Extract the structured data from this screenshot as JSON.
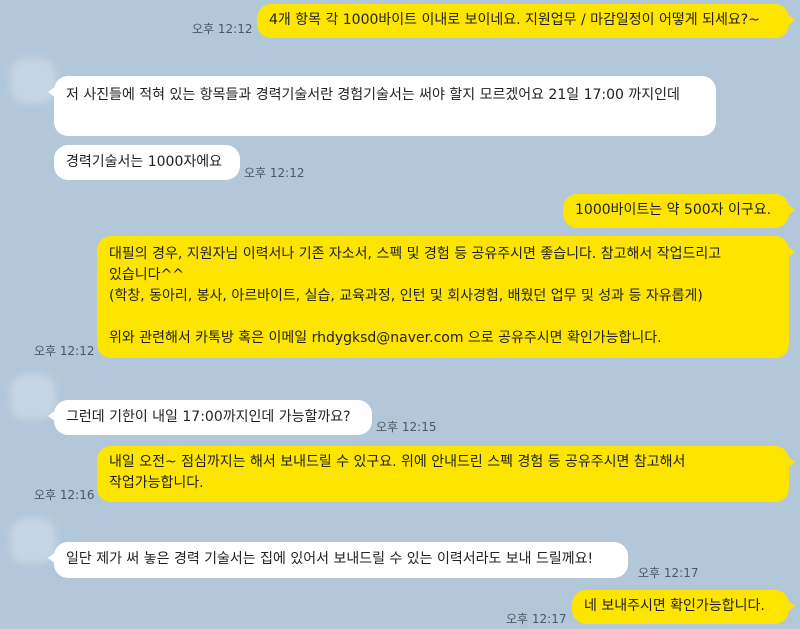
{
  "messages": [
    {
      "text": "4개 항목 각 1000바이트 이내로 보이네요. 지원업무 / 마감일정이 어떻게 되세요?~",
      "time": "오후 12:12"
    },
    {
      "text": "저 사진들에 적혀 있는 항목들과 경력기술서란 경험기술서는 써야 할지 모르겠어요 21일 17:00 까지인데",
      "time": ""
    },
    {
      "text": "경력기술서는 1000자에요",
      "time": "오후 12:12"
    },
    {
      "text": "1000바이트는 약 500자 이구요.",
      "time": ""
    },
    {
      "text": "대필의 경우, 지원자님 이력서나 기존 자소서, 스펙 및 경험 등 공유주시면 좋습니다. 참고해서 작업드리고 있습니다^^\n(학창, 동아리, 봉사, 아르바이트, 실습, 교육과정, 인턴 및 회사경험, 배웠던 업무 및 성과 등 자유롭게)\n\n위와 관련해서 카톡방 혹은 이메일 rhdygksd@naver.com 으로 공유주시면 확인가능합니다.",
      "time": "오후 12:12"
    },
    {
      "text": "그런데 기한이 내일 17:00까지인데 가능할까요?",
      "time": "오후 12:15"
    },
    {
      "text": "내일 오전~ 점심까지는 해서 보내드릴 수 있구요. 위에 안내드린 스펙 경험 등 공유주시면 참고해서 작업가능합니다.",
      "time": "오후 12:16"
    },
    {
      "text": "일단 제가 써 놓은 경력 기술서는 집에 있어서 보내드릴 수 있는 이력서라도 보내 드릴께요!",
      "time": "오후 12:17"
    },
    {
      "text": "네 보내주시면 확인가능합니다.",
      "time": "오후 12:17"
    }
  ]
}
